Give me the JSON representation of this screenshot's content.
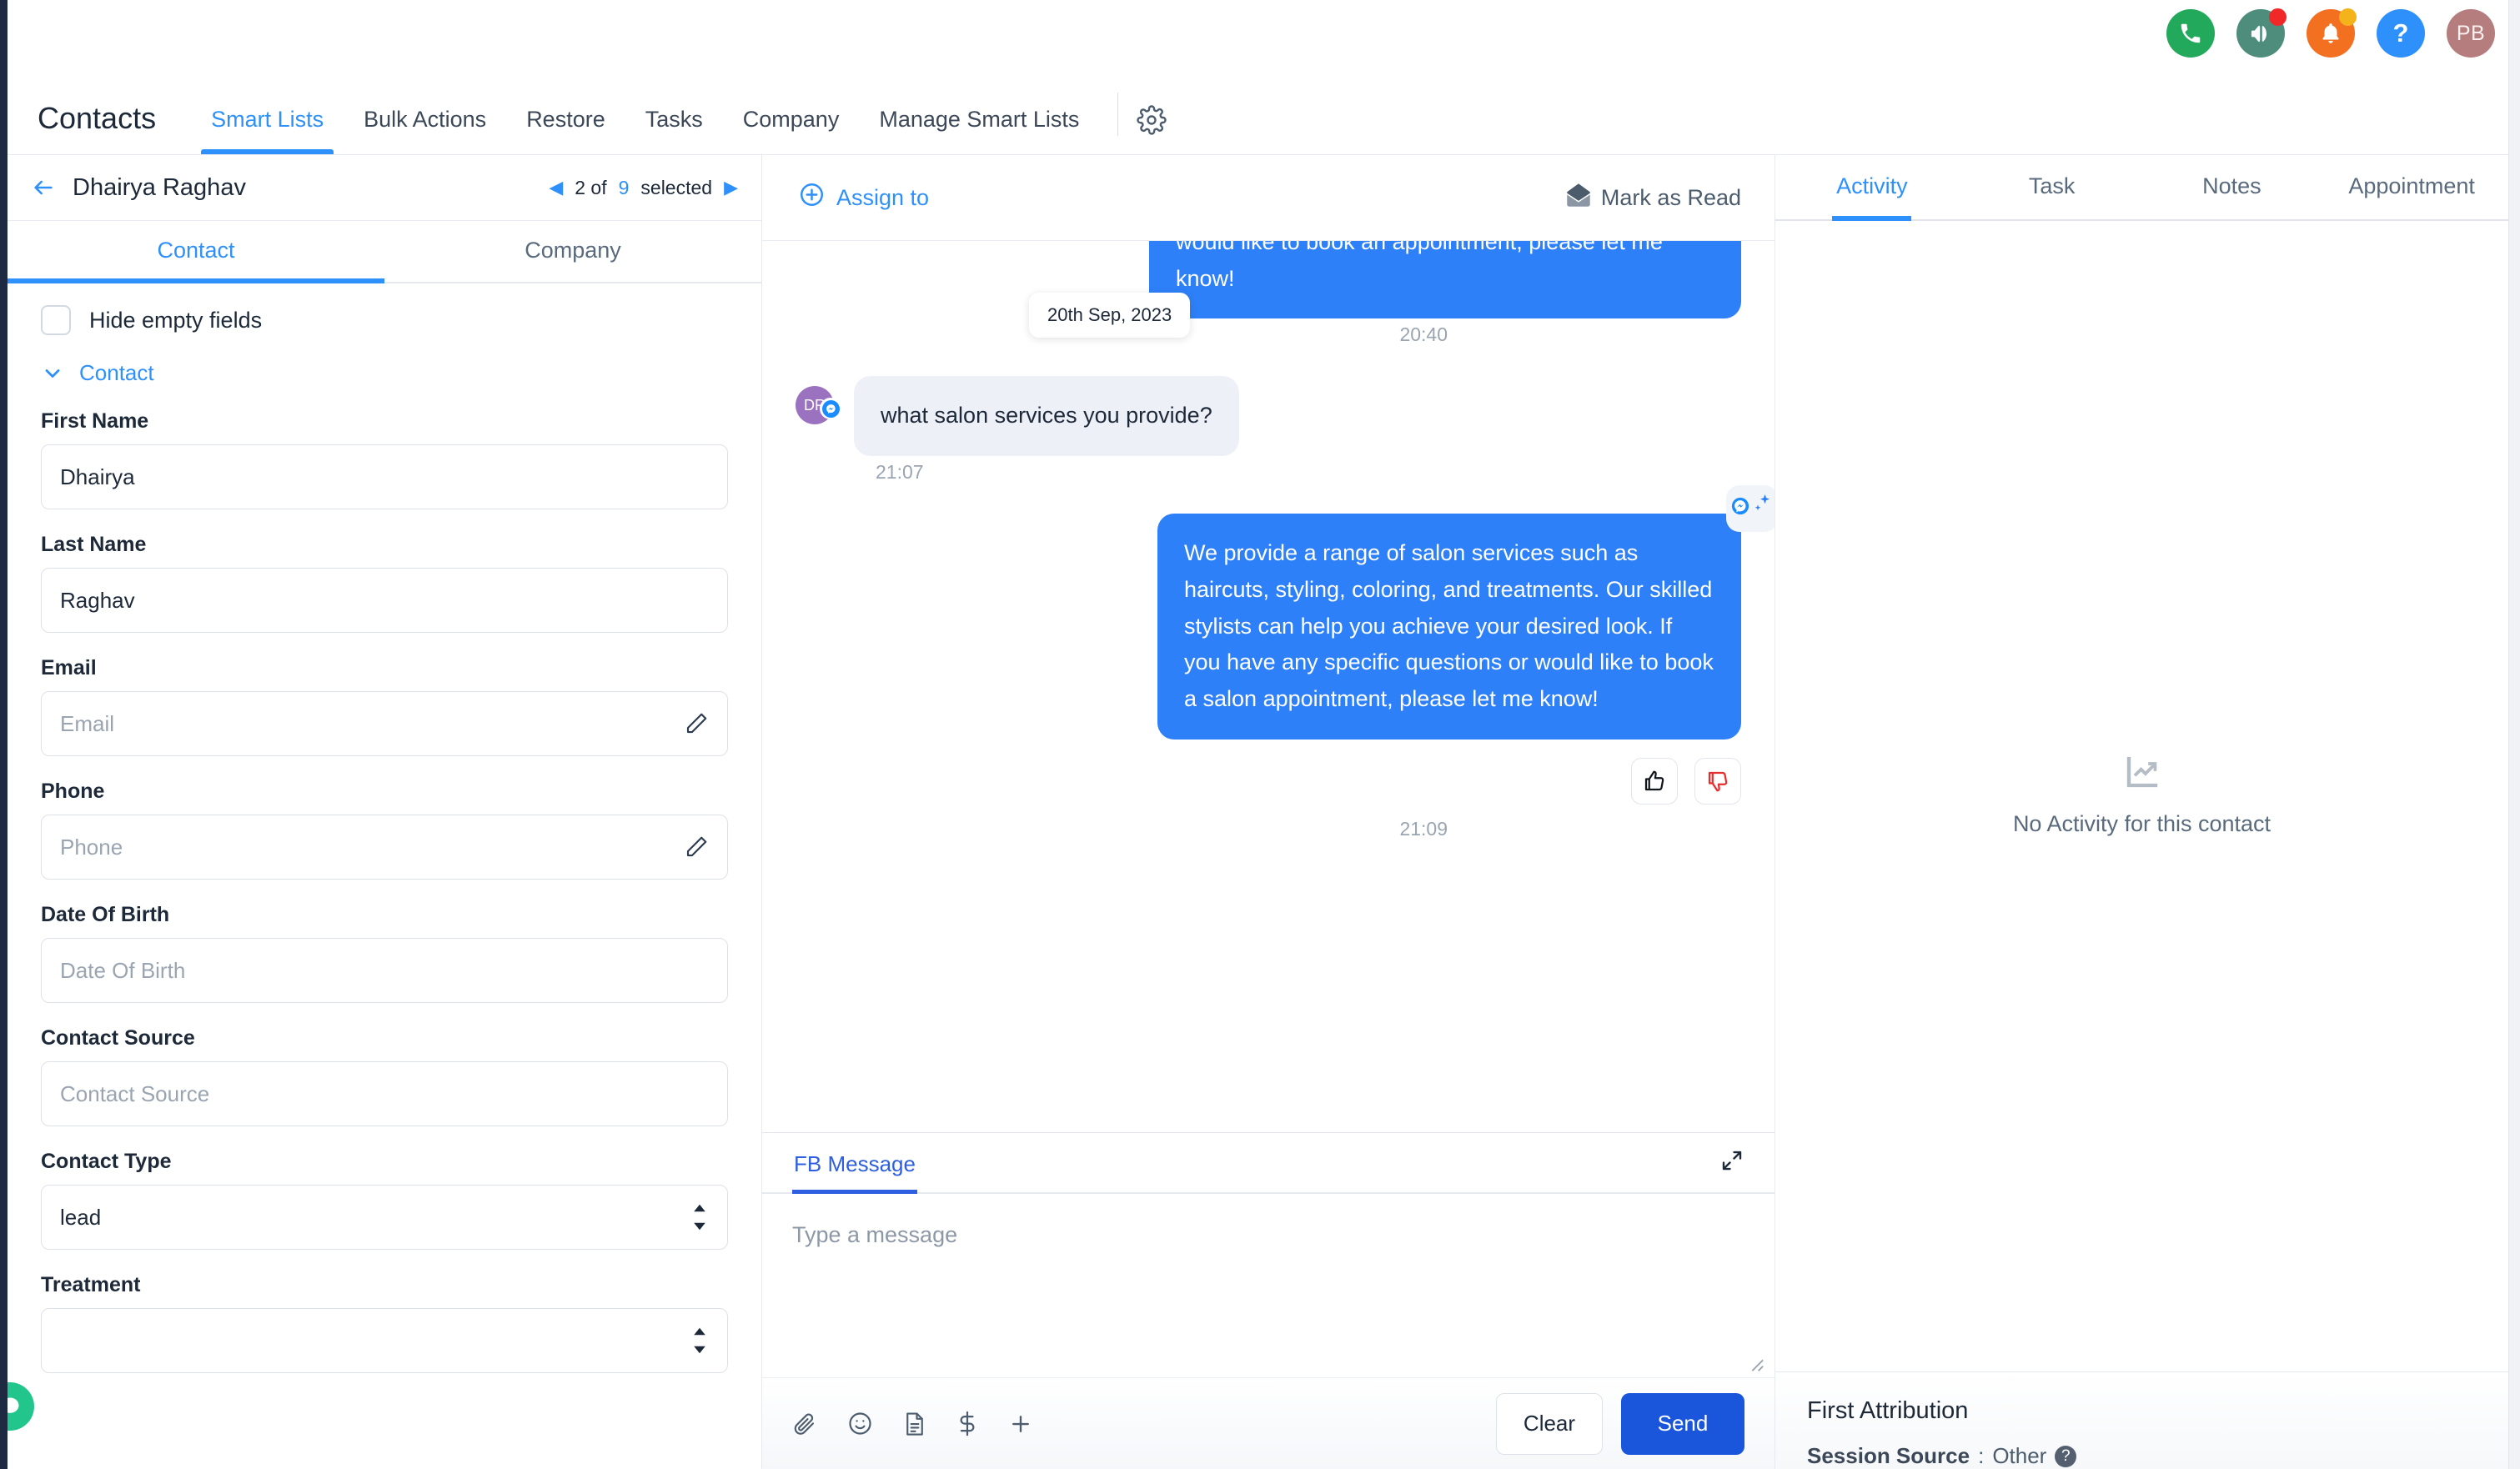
{
  "topbar": {
    "icons": [
      {
        "name": "phone-icon",
        "color": "#22a95b",
        "badge": null
      },
      {
        "name": "megaphone-icon",
        "color": "#4e8d7c",
        "badge": "#f02828"
      },
      {
        "name": "bell-icon",
        "color": "#f37021",
        "badge": "#f5b31b"
      },
      {
        "name": "help-icon",
        "color": "#2e90fa",
        "badge": null
      },
      {
        "name": "user-avatar",
        "color": "#b57d7d",
        "badge": null,
        "initials": "PB"
      }
    ]
  },
  "nav": {
    "title": "Contacts",
    "items": [
      {
        "label": "Smart Lists",
        "active": true
      },
      {
        "label": "Bulk Actions",
        "active": false
      },
      {
        "label": "Restore",
        "active": false
      },
      {
        "label": "Tasks",
        "active": false
      },
      {
        "label": "Company",
        "active": false
      },
      {
        "label": "Manage Smart Lists",
        "active": false
      }
    ],
    "gear_icon": "gear-icon"
  },
  "contact_panel": {
    "back_icon": "back-arrow-icon",
    "name": "Dhairya Raghav",
    "selection": {
      "prev": "◀",
      "index": "2 of",
      "count": "9",
      "label": "selected",
      "next": "▶"
    },
    "tabs": [
      {
        "label": "Contact",
        "active": true
      },
      {
        "label": "Company",
        "active": false
      }
    ],
    "hide_empty_label": "Hide empty fields",
    "section_label": "Contact",
    "fields": [
      {
        "label": "First Name",
        "value": "Dhairya",
        "placeholder": "First Name",
        "type": "text",
        "icon": null
      },
      {
        "label": "Last Name",
        "value": "Raghav",
        "placeholder": "Last Name",
        "type": "text",
        "icon": null
      },
      {
        "label": "Email",
        "value": "",
        "placeholder": "Email",
        "type": "text",
        "icon": "pencil-icon"
      },
      {
        "label": "Phone",
        "value": "",
        "placeholder": "Phone",
        "type": "text",
        "icon": "pencil-icon"
      },
      {
        "label": "Date Of Birth",
        "value": "",
        "placeholder": "Date Of Birth",
        "type": "text",
        "icon": null
      },
      {
        "label": "Contact Source",
        "value": "",
        "placeholder": "Contact Source",
        "type": "text",
        "icon": null
      },
      {
        "label": "Contact Type",
        "value": "lead",
        "placeholder": "Contact Type",
        "type": "select",
        "icon": "stepper-icon"
      },
      {
        "label": "Treatment",
        "value": "",
        "placeholder": "",
        "type": "select",
        "icon": "stepper-icon"
      }
    ],
    "fab_icon": "chat-fab-icon"
  },
  "conversation": {
    "assign_to_label": "Assign to",
    "assign_icon": "plus-circle-icon",
    "mark_read_label": "Mark as Read",
    "mark_read_icon": "envelope-icon",
    "date_chip": "20th Sep, 2023",
    "messages": [
      {
        "direction": "out",
        "text": "would like to book an appointment, please let me know!",
        "time": "20:40",
        "avatar": null,
        "ai_badge": false,
        "feedback": false,
        "clipped_top": true
      },
      {
        "direction": "in",
        "text": "what salon services you provide?",
        "time": "21:07",
        "avatar": {
          "initials": "DR",
          "color": "#9b72bf",
          "channel_icon": "messenger-icon"
        },
        "ai_badge": false,
        "feedback": false,
        "clipped_top": false
      },
      {
        "direction": "out",
        "text": "We provide a range of salon services such as haircuts, styling, coloring, and treatments. Our skilled stylists can help you achieve your desired look. If you have any specific questions or would like to book a salon appointment, please let me know!",
        "time": "21:09",
        "avatar": null,
        "ai_badge": true,
        "feedback": true,
        "clipped_top": false
      }
    ],
    "feedback_icons": {
      "up": "thumbs-up-icon",
      "down": "thumbs-down-icon"
    },
    "composer": {
      "tab_label": "FB Message",
      "expand_icon": "collapse-arrows-icon",
      "placeholder": "Type a message",
      "toolbar_icons": [
        "attachment-icon",
        "emoji-icon",
        "document-icon",
        "dollar-icon",
        "plus-icon"
      ],
      "clear_label": "Clear",
      "send_label": "Send"
    }
  },
  "right_panel": {
    "tabs": [
      {
        "label": "Activity",
        "active": true
      },
      {
        "label": "Task",
        "active": false
      },
      {
        "label": "Notes",
        "active": false
      },
      {
        "label": "Appointment",
        "active": false
      }
    ],
    "empty_icon": "chart-trend-icon",
    "empty_text": "No Activity for this contact",
    "attribution": {
      "title": "First Attribution",
      "key": "Session Source",
      "separator": ":",
      "value": "Other",
      "help_icon": "question-icon",
      "help_glyph": "?"
    }
  },
  "colors": {
    "accent_blue": "#2e90fa",
    "bubble_blue": "#2e80f8",
    "send_blue": "#1a56db",
    "bubble_gray": "#eef0f8",
    "rail_navy": "#1e2a42",
    "green": "#22c58b"
  }
}
